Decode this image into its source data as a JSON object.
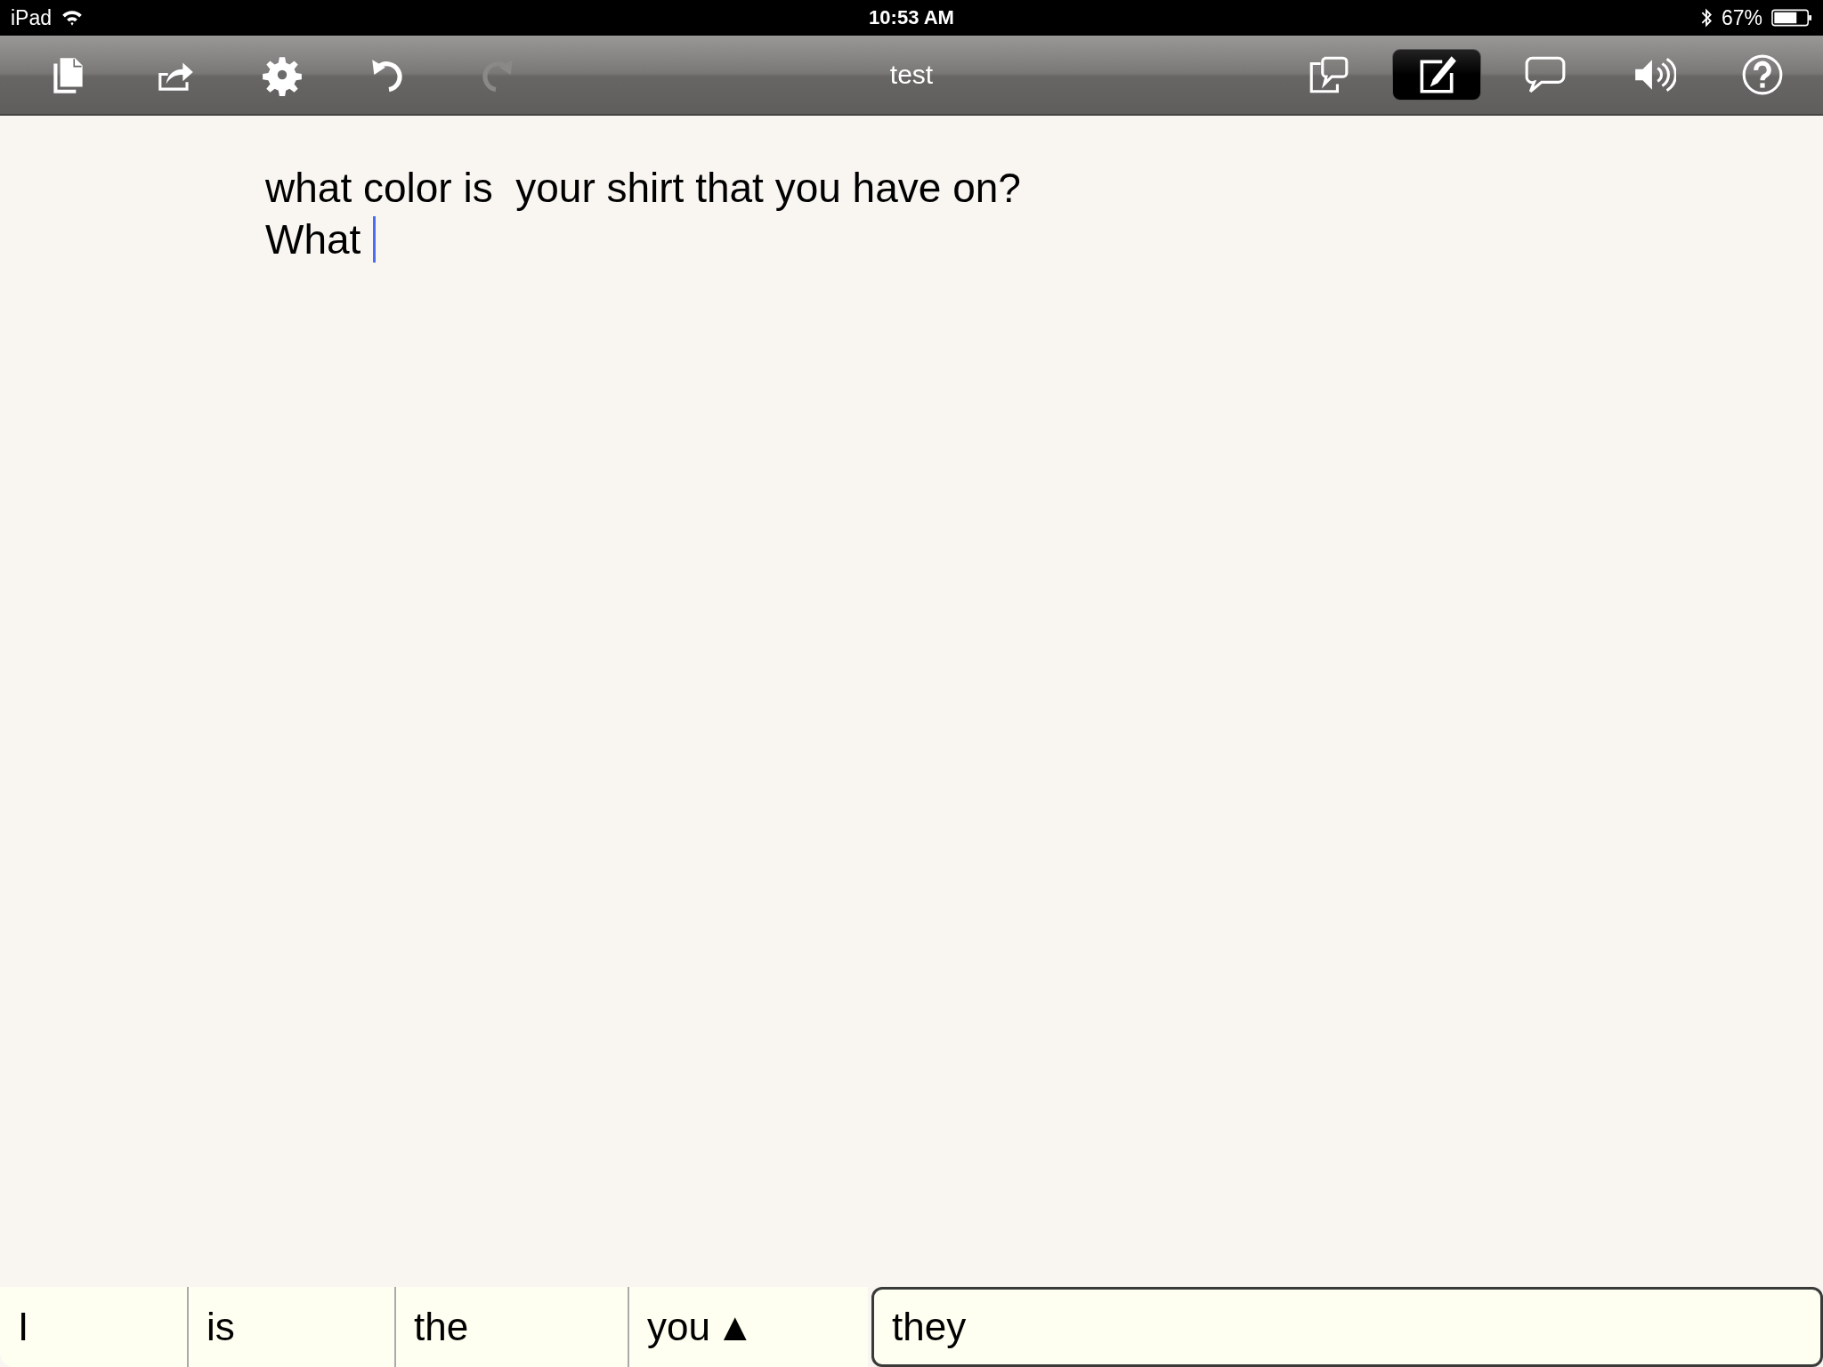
{
  "status_bar": {
    "carrier": "iPad",
    "time": "10:53 AM",
    "battery": "67%"
  },
  "toolbar": {
    "title": "test",
    "left_buttons": [
      {
        "kind": "documents",
        "disabled": false
      },
      {
        "kind": "share",
        "disabled": false
      },
      {
        "kind": "settings",
        "disabled": false
      },
      {
        "kind": "undo",
        "disabled": false
      },
      {
        "kind": "redo",
        "disabled": true
      }
    ],
    "right_buttons": [
      {
        "kind": "phrases",
        "selected": false
      },
      {
        "kind": "edit",
        "selected": true
      },
      {
        "kind": "speak",
        "selected": false
      },
      {
        "kind": "volume",
        "selected": false
      },
      {
        "kind": "help",
        "selected": false
      }
    ]
  },
  "document": {
    "lines": [
      "what color is  your shirt that you have on?",
      "What"
    ]
  },
  "predictions": [
    {
      "word": "I",
      "selected": false
    },
    {
      "word": "is",
      "selected": false
    },
    {
      "word": "the",
      "selected": false
    },
    {
      "word": "you",
      "indicator": "▲",
      "selected": false
    },
    {
      "word": "they",
      "selected": true
    }
  ]
}
